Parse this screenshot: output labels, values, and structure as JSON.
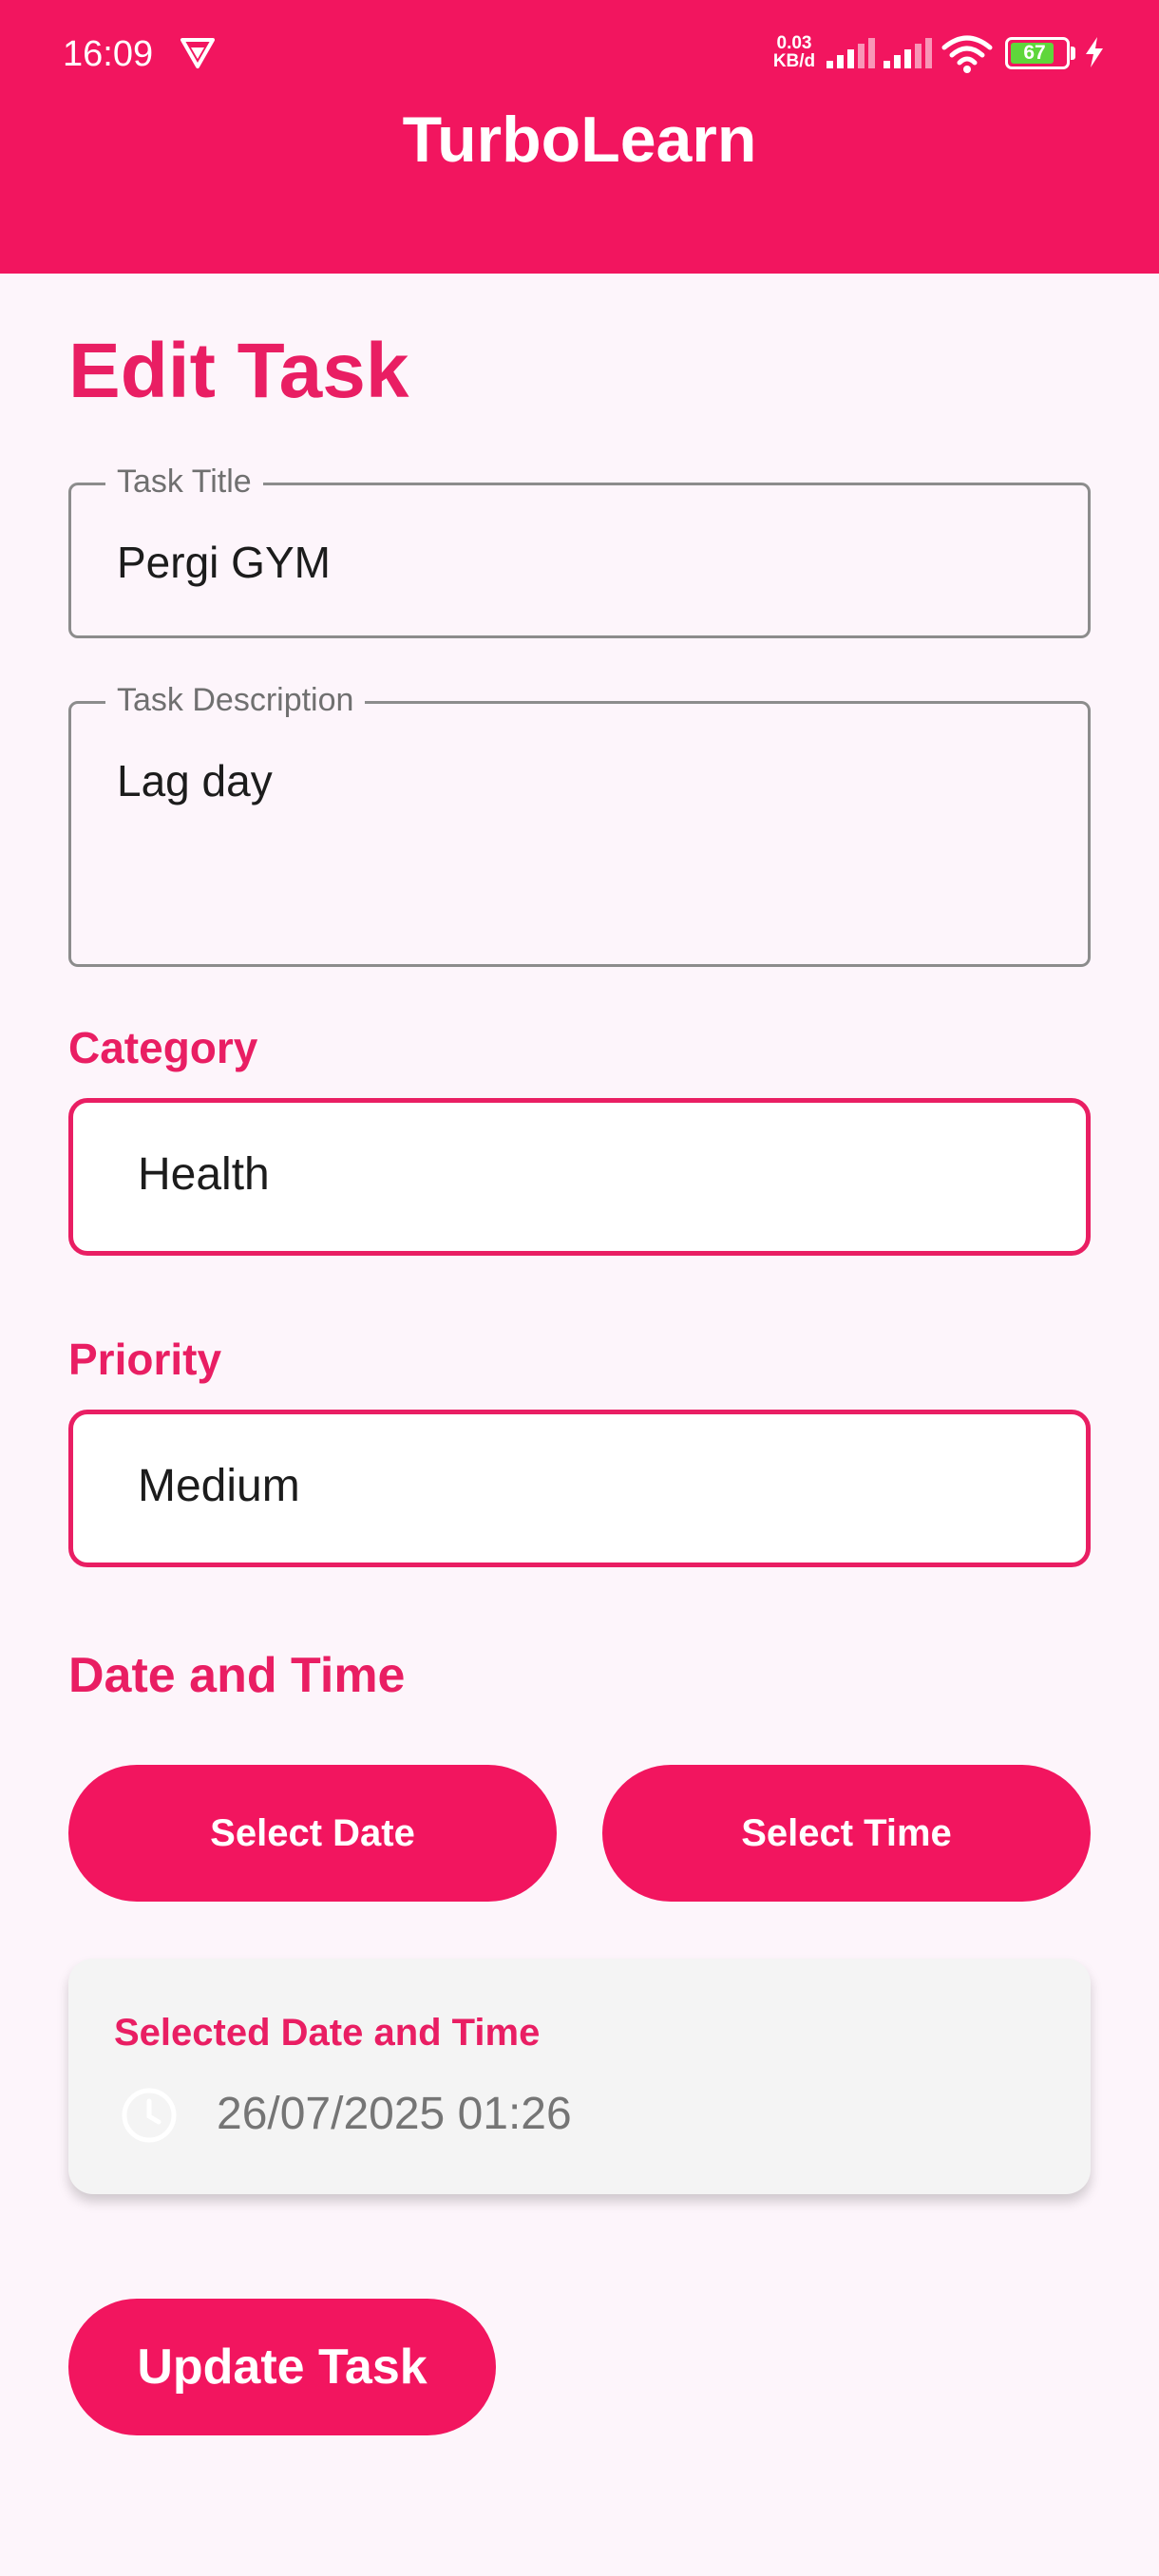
{
  "status_bar": {
    "time": "16:09",
    "net_speed_value": "0.03",
    "net_speed_unit": "KB/d",
    "battery": "67"
  },
  "app_bar": {
    "title": "TurboLearn"
  },
  "page": {
    "title": "Edit Task"
  },
  "form": {
    "task_title": {
      "label": "Task Title",
      "value": "Pergi GYM"
    },
    "task_description": {
      "label": "Task Description",
      "value": "Lag day"
    },
    "category": {
      "label": "Category",
      "value": "Health"
    },
    "priority": {
      "label": "Priority",
      "value": "Medium"
    },
    "date_time": {
      "label": "Date and Time",
      "select_date": "Select Date",
      "select_time": "Select Time"
    },
    "selected_card": {
      "title": "Selected Date and Time",
      "value": "26/07/2025 01:26",
      "icon": "clock-icon"
    },
    "update_button": "Update Task"
  },
  "colors": {
    "primary": "#f2155f",
    "accent_text": "#e91e63",
    "background": "#fdf5fb"
  }
}
